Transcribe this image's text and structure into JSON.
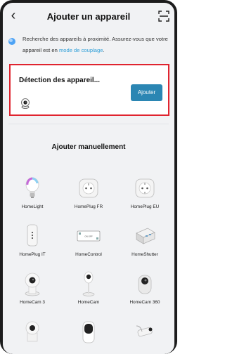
{
  "header": {
    "back_icon": "chevron-left-icon",
    "title": "Ajouter un appareil",
    "scan_icon": "scan-icon"
  },
  "info": {
    "text": "Recherche des appareils à proximité. Assurez-vous que votre appareil est en",
    "link": "mode de couplage",
    "end": "."
  },
  "detection": {
    "title": "Détection des appareil...",
    "add_label": "Ajouter"
  },
  "manual": {
    "title": "Ajouter manuellement",
    "devices": [
      {
        "label": "HomeLight",
        "icon": "bulb-icon"
      },
      {
        "label": "HomePlug FR",
        "icon": "plug-fr-icon"
      },
      {
        "label": "HomePlug EU",
        "icon": "plug-eu-icon"
      },
      {
        "label": "HomePlug IT",
        "icon": "plug-it-icon"
      },
      {
        "label": "HomeControl",
        "icon": "control-module-icon"
      },
      {
        "label": "HomeShutter",
        "icon": "shutter-module-icon"
      },
      {
        "label": "HomeCam 3",
        "icon": "camera-icon"
      },
      {
        "label": "HomeCam",
        "icon": "camera-icon"
      },
      {
        "label": "HomeCam 360",
        "icon": "camera-360-icon"
      }
    ],
    "switch_label": "ON OFF"
  },
  "colors": {
    "accent": "#2b86b3",
    "highlight_border": "#e0242f",
    "link": "#2f9fd8"
  }
}
